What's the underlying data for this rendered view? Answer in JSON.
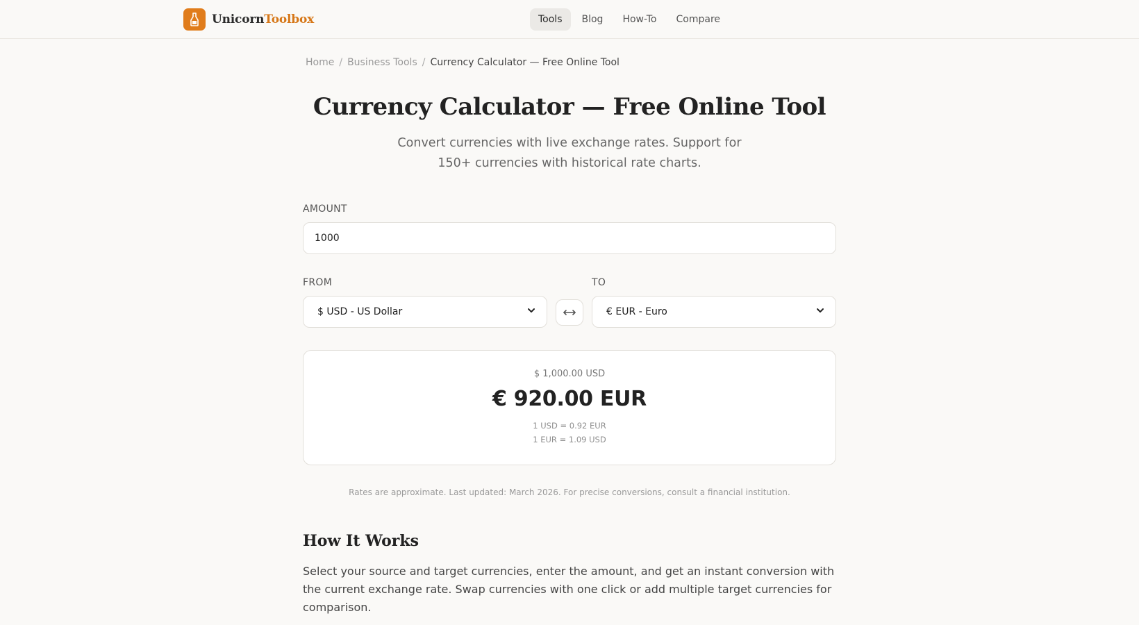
{
  "header": {
    "brand_part1": "Unicorn",
    "brand_part2": "Toolbox",
    "nav": [
      {
        "label": "Tools",
        "active": true
      },
      {
        "label": "Blog"
      },
      {
        "label": "How-To"
      },
      {
        "label": "Compare"
      }
    ]
  },
  "breadcrumb": {
    "home": "Home",
    "section": "Business Tools",
    "current": "Currency Calculator — Free Online Tool",
    "separator": "/"
  },
  "page": {
    "title": "Currency Calculator — Free Online Tool",
    "subtitle": "Convert currencies with live exchange rates. Support for 150+ currencies with historical rate charts."
  },
  "form": {
    "amount_label": "AMOUNT",
    "amount_value": "1000",
    "from_label": "FROM",
    "from_value": "$ USD - US Dollar",
    "to_label": "TO",
    "to_value": "€ EUR - Euro"
  },
  "result": {
    "from_amount": "$ 1,000.00 USD",
    "converted": "€ 920.00 EUR",
    "rate_forward": "1 USD = 0.92 EUR",
    "rate_reverse": "1 EUR = 1.09 USD"
  },
  "disclaimer": "Rates are approximate. Last updated: March 2026. For precise conversions, consult a financial institution.",
  "how_it_works": {
    "title": "How It Works",
    "body": "Select your source and target currencies, enter the amount, and get an instant conversion with the current exchange rate. Swap currencies with one click or add multiple target currencies for comparison."
  },
  "colors": {
    "brand": "#e07c1b",
    "background": "#faf9f7"
  }
}
